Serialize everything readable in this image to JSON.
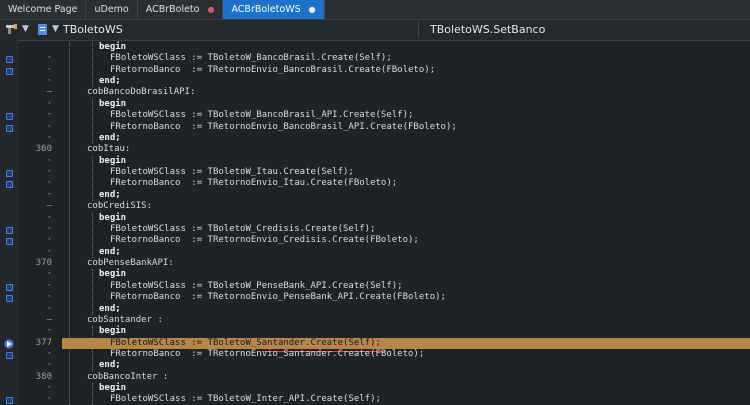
{
  "tabs": [
    {
      "label": "Welcome Page",
      "active": false,
      "modified": false
    },
    {
      "label": "uDemo",
      "active": false,
      "modified": false
    },
    {
      "label": "ACBrBoleto",
      "active": false,
      "modified": true
    },
    {
      "label": "ACBrBoletoWS",
      "active": true,
      "modified": true
    }
  ],
  "navbar": {
    "class_selector": "TBoletoWS",
    "method_selector": "TBoletoWS.SetBanco",
    "icons": [
      "tools-icon",
      "chevron-down-icon",
      "document-icon",
      "chevron-down-icon"
    ]
  },
  "editor": {
    "colors": {
      "background": "#1f2326",
      "current_line": "#b8864a",
      "breakpoint": "#4a7fd8",
      "error_squiggle": "#e04040"
    },
    "lines": [
      {
        "n": "",
        "gutter": "",
        "bp": false,
        "text": "begin",
        "kw": true,
        "indent": 1
      },
      {
        "n": "",
        "gutter": "·",
        "bp": true,
        "text": "FBoletoWSClass := TBoletoW_BancoBrasil.Create(Self);",
        "kw": false,
        "indent": 2
      },
      {
        "n": "",
        "gutter": "·",
        "bp": true,
        "text": "FRetornoBanco  := TRetornoEnvio_BancoBrasil.Create(FBoleto);",
        "kw": false,
        "indent": 2
      },
      {
        "n": "",
        "gutter": "·",
        "bp": false,
        "text": "end;",
        "kw": true,
        "indent": 1
      },
      {
        "n": "",
        "gutter": "–",
        "bp": false,
        "text": "cobBancoDoBrasilAPI:",
        "kw": false,
        "indent": 0
      },
      {
        "n": "",
        "gutter": "·",
        "bp": false,
        "text": "begin",
        "kw": true,
        "indent": 1
      },
      {
        "n": "",
        "gutter": "·",
        "bp": true,
        "text": "FBoletoWSClass := TBoletoW_BancoBrasil_API.Create(Self);",
        "kw": false,
        "indent": 2
      },
      {
        "n": "",
        "gutter": "·",
        "bp": true,
        "text": "FRetornoBanco  := TRetornoEnvio_BancoBrasil_API.Create(FBoleto);",
        "kw": false,
        "indent": 2
      },
      {
        "n": "",
        "gutter": "·",
        "bp": false,
        "text": "end;",
        "kw": true,
        "indent": 1
      },
      {
        "n": "360",
        "gutter": "",
        "bp": false,
        "text": "cobItau:",
        "kw": false,
        "indent": 0
      },
      {
        "n": "",
        "gutter": "·",
        "bp": false,
        "text": "begin",
        "kw": true,
        "indent": 1
      },
      {
        "n": "",
        "gutter": "·",
        "bp": true,
        "text": "FBoletoWSClass := TBoletoW_Itau.Create(Self);",
        "kw": false,
        "indent": 2
      },
      {
        "n": "",
        "gutter": "·",
        "bp": true,
        "text": "FRetornoBanco  := TRetornoEnvio_Itau.Create(FBoleto);",
        "kw": false,
        "indent": 2
      },
      {
        "n": "",
        "gutter": "·",
        "bp": false,
        "text": "end;",
        "kw": true,
        "indent": 1
      },
      {
        "n": "",
        "gutter": "–",
        "bp": false,
        "text": "cobCrediSIS:",
        "kw": false,
        "indent": 0
      },
      {
        "n": "",
        "gutter": "·",
        "bp": false,
        "text": "begin",
        "kw": true,
        "indent": 1
      },
      {
        "n": "",
        "gutter": "·",
        "bp": true,
        "text": "FBoletoWSClass := TBoletoW_Credisis.Create(Self);",
        "kw": false,
        "indent": 2
      },
      {
        "n": "",
        "gutter": "·",
        "bp": true,
        "text": "FRetornoBanco  := TRetornoEnvio_Credisis.Create(FBoleto);",
        "kw": false,
        "indent": 2
      },
      {
        "n": "",
        "gutter": "·",
        "bp": false,
        "text": "end;",
        "kw": true,
        "indent": 1
      },
      {
        "n": "370",
        "gutter": "",
        "bp": false,
        "text": "cobPenseBankAPI:",
        "kw": false,
        "indent": 0
      },
      {
        "n": "",
        "gutter": "·",
        "bp": false,
        "text": "begin",
        "kw": true,
        "indent": 1
      },
      {
        "n": "",
        "gutter": "·",
        "bp": true,
        "text": "FBoletoWSClass := TBoletoW_PenseBank_API.Create(Self);",
        "kw": false,
        "indent": 2
      },
      {
        "n": "",
        "gutter": "·",
        "bp": true,
        "text": "FRetornoBanco  := TRetornoEnvio_PenseBank_API.Create(FBoleto);",
        "kw": false,
        "indent": 2
      },
      {
        "n": "",
        "gutter": "·",
        "bp": false,
        "text": "end;",
        "kw": true,
        "indent": 1
      },
      {
        "n": "",
        "gutter": "–",
        "bp": false,
        "text": "cobSantander :",
        "kw": false,
        "indent": 0
      },
      {
        "n": "",
        "gutter": "·",
        "bp": false,
        "text": "begin",
        "kw": true,
        "indent": 1
      },
      {
        "n": "377",
        "gutter": "",
        "bp": false,
        "exec": true,
        "hl": true,
        "text": "FBoletoWSClass := TBoletoW_Santander.Create(Self);",
        "kw": false,
        "indent": 2
      },
      {
        "n": "",
        "gutter": "·",
        "bp": true,
        "text": "FRetornoBanco  := TRetornoEnvio_Santander.Create(FBoleto);",
        "kw": false,
        "indent": 2
      },
      {
        "n": "",
        "gutter": "·",
        "bp": false,
        "text": "end;",
        "kw": true,
        "indent": 1
      },
      {
        "n": "380",
        "gutter": "",
        "bp": false,
        "text": "cobBancoInter :",
        "kw": false,
        "indent": 0
      },
      {
        "n": "",
        "gutter": "·",
        "bp": false,
        "text": "begin",
        "kw": true,
        "indent": 1
      },
      {
        "n": "",
        "gutter": "·",
        "bp": true,
        "text": "FBoletoWSClass := TBoletoW_Inter_API.Create(Self);",
        "kw": false,
        "indent": 2
      }
    ]
  }
}
